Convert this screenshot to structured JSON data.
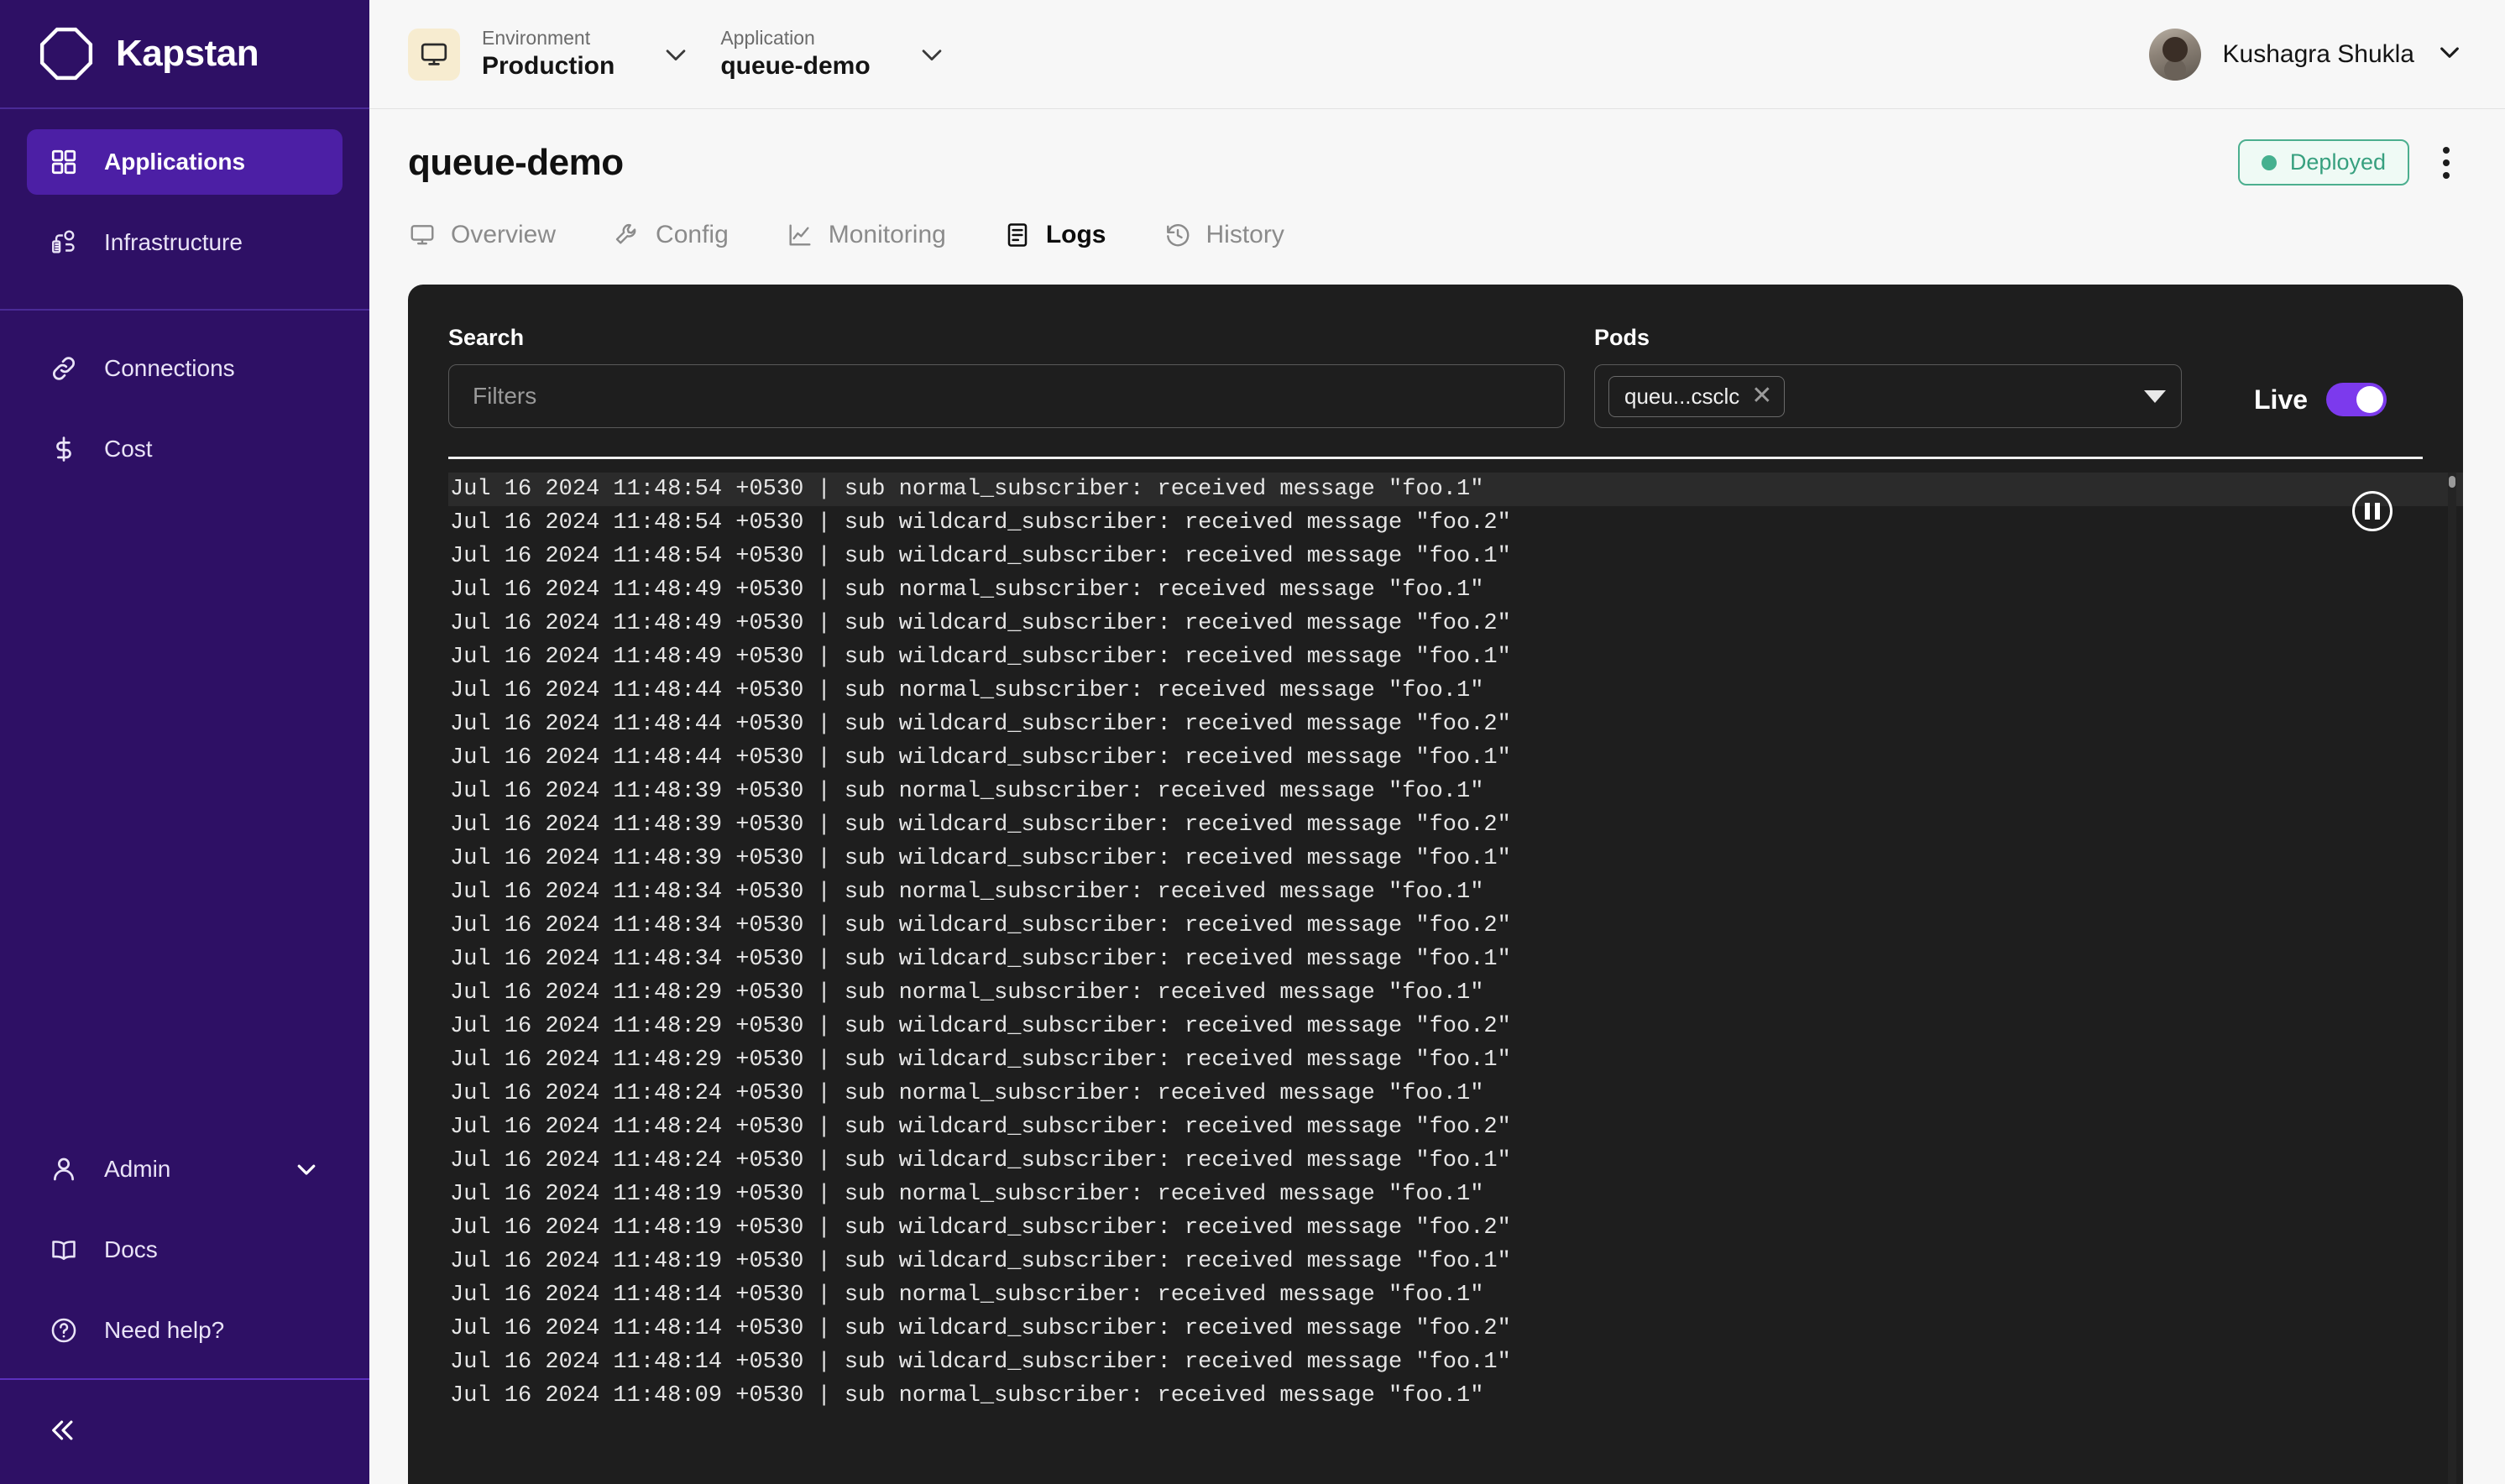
{
  "sidebar": {
    "brand": "Kapstan",
    "logo_icon": "octagon-logo-icon",
    "primary_items": [
      {
        "label": "Applications",
        "icon": "grid-icon",
        "active": true
      },
      {
        "label": "Infrastructure",
        "icon": "infrastructure-icon",
        "active": false
      }
    ],
    "secondary_items": [
      {
        "label": "Connections",
        "icon": "link-icon",
        "active": false
      },
      {
        "label": "Cost",
        "icon": "dollar-icon",
        "active": false
      }
    ],
    "bottom_items": [
      {
        "label": "Admin",
        "icon": "user-icon",
        "has_chevron": true
      },
      {
        "label": "Docs",
        "icon": "book-icon",
        "has_chevron": false
      },
      {
        "label": "Need help?",
        "icon": "question-circle-icon",
        "has_chevron": false
      }
    ],
    "collapse_icon": "double-chevron-left-icon"
  },
  "topbar": {
    "environment": {
      "label": "Environment",
      "value": "Production",
      "icon": "monitor-icon",
      "chevron": "chevron-down-icon"
    },
    "application": {
      "label": "Application",
      "value": "queue-demo",
      "chevron": "chevron-down-icon"
    },
    "user": {
      "name": "Kushagra Shukla",
      "avatar": "user-avatar",
      "chevron": "chevron-down-icon"
    }
  },
  "page": {
    "title": "queue-demo",
    "status_badge": "Deployed",
    "kebab_icon": "more-vertical-icon",
    "tabs": [
      {
        "label": "Overview",
        "icon": "monitor-icon",
        "active": false
      },
      {
        "label": "Config",
        "icon": "wrench-icon",
        "active": false
      },
      {
        "label": "Monitoring",
        "icon": "chart-line-icon",
        "active": false
      },
      {
        "label": "Logs",
        "icon": "document-lines-icon",
        "active": true
      },
      {
        "label": "History",
        "icon": "clock-rewind-icon",
        "active": false
      }
    ]
  },
  "logs": {
    "search_label": "Search",
    "search_value": "",
    "search_placeholder": "Filters",
    "pods_label": "Pods",
    "pods_chip": "queu...csclc",
    "pods_chip_remove_icon": "close-icon",
    "pods_caret_icon": "caret-down-icon",
    "live_label": "Live",
    "live_enabled": true,
    "pause_icon": "pause-circle-icon",
    "lines": [
      "Jul 16 2024 11:48:54 +0530 | sub normal_subscriber: received message \"foo.1\"",
      "Jul 16 2024 11:48:54 +0530 | sub wildcard_subscriber: received message \"foo.2\"",
      "Jul 16 2024 11:48:54 +0530 | sub wildcard_subscriber: received message \"foo.1\"",
      "Jul 16 2024 11:48:49 +0530 | sub normal_subscriber: received message \"foo.1\"",
      "Jul 16 2024 11:48:49 +0530 | sub wildcard_subscriber: received message \"foo.2\"",
      "Jul 16 2024 11:48:49 +0530 | sub wildcard_subscriber: received message \"foo.1\"",
      "Jul 16 2024 11:48:44 +0530 | sub normal_subscriber: received message \"foo.1\"",
      "Jul 16 2024 11:48:44 +0530 | sub wildcard_subscriber: received message \"foo.2\"",
      "Jul 16 2024 11:48:44 +0530 | sub wildcard_subscriber: received message \"foo.1\"",
      "Jul 16 2024 11:48:39 +0530 | sub normal_subscriber: received message \"foo.1\"",
      "Jul 16 2024 11:48:39 +0530 | sub wildcard_subscriber: received message \"foo.2\"",
      "Jul 16 2024 11:48:39 +0530 | sub wildcard_subscriber: received message \"foo.1\"",
      "Jul 16 2024 11:48:34 +0530 | sub normal_subscriber: received message \"foo.1\"",
      "Jul 16 2024 11:48:34 +0530 | sub wildcard_subscriber: received message \"foo.2\"",
      "Jul 16 2024 11:48:34 +0530 | sub wildcard_subscriber: received message \"foo.1\"",
      "Jul 16 2024 11:48:29 +0530 | sub normal_subscriber: received message \"foo.1\"",
      "Jul 16 2024 11:48:29 +0530 | sub wildcard_subscriber: received message \"foo.2\"",
      "Jul 16 2024 11:48:29 +0530 | sub wildcard_subscriber: received message \"foo.1\"",
      "Jul 16 2024 11:48:24 +0530 | sub normal_subscriber: received message \"foo.1\"",
      "Jul 16 2024 11:48:24 +0530 | sub wildcard_subscriber: received message \"foo.2\"",
      "Jul 16 2024 11:48:24 +0530 | sub wildcard_subscriber: received message \"foo.1\"",
      "Jul 16 2024 11:48:19 +0530 | sub normal_subscriber: received message \"foo.1\"",
      "Jul 16 2024 11:48:19 +0530 | sub wildcard_subscriber: received message \"foo.2\"",
      "Jul 16 2024 11:48:19 +0530 | sub wildcard_subscriber: received message \"foo.1\"",
      "Jul 16 2024 11:48:14 +0530 | sub normal_subscriber: received message \"foo.1\"",
      "Jul 16 2024 11:48:14 +0530 | sub wildcard_subscriber: received message \"foo.2\"",
      "Jul 16 2024 11:48:14 +0530 | sub wildcard_subscriber: received message \"foo.1\"",
      "Jul 16 2024 11:48:09 +0530 | sub normal_subscriber: received message \"foo.1\""
    ]
  },
  "colors": {
    "sidebar_bg": "#2e1065",
    "sidebar_active": "#4c1fa5",
    "accent": "#7c3aed",
    "env_icon_bg": "#f7ecd0",
    "status_green": "#37a07f",
    "logs_bg": "#1e1e1e"
  }
}
